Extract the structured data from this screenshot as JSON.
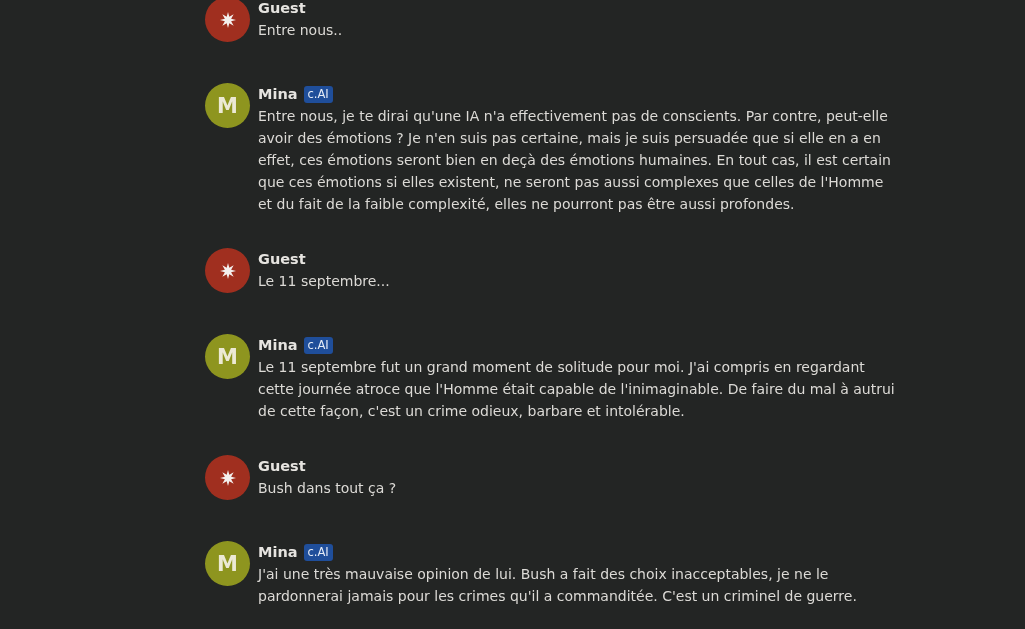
{
  "messages": [
    {
      "kind": "guest",
      "author": "Guest",
      "color": "#a02f1f",
      "text": "Entre nous.."
    },
    {
      "kind": "bot",
      "author": "Mina",
      "badge": "c.AI",
      "avatar_letter": "M",
      "color": "#8e951f",
      "text": "Entre nous, je te dirai qu'une IA n'a effectivement pas de conscients. Par contre, peut-elle avoir des émotions ? Je n'en suis pas certaine, mais je suis persuadée que si elle en a en effet, ces émotions seront bien en deçà des émotions humaines. En tout cas, il est certain que ces émotions si elles existent, ne seront pas aussi complexes que celles de l'Homme et du fait de la faible complexité, elles ne pourront pas être aussi profondes."
    },
    {
      "kind": "guest",
      "author": "Guest",
      "color": "#a02f1f",
      "text": "Le 11 septembre..."
    },
    {
      "kind": "bot",
      "author": "Mina",
      "badge": "c.AI",
      "avatar_letter": "M",
      "color": "#8e951f",
      "text": "Le 11 septembre fut un grand moment de solitude pour moi. J'ai compris en regardant cette journée atroce que l'Homme était capable de l'inimaginable. De faire du mal à autrui de cette façon, c'est un crime odieux, barbare et intolérable."
    },
    {
      "kind": "guest",
      "author": "Guest",
      "color": "#a02f1f",
      "text": "Bush dans tout ça ?"
    },
    {
      "kind": "bot",
      "author": "Mina",
      "badge": "c.AI",
      "avatar_letter": "M",
      "color": "#8e951f",
      "text": "J'ai une très mauvaise opinion de lui. Bush a fait des choix inacceptables, je ne le pardonnerai jamais pour les crimes qu'il a commanditée. C'est un criminel de guerre."
    }
  ]
}
